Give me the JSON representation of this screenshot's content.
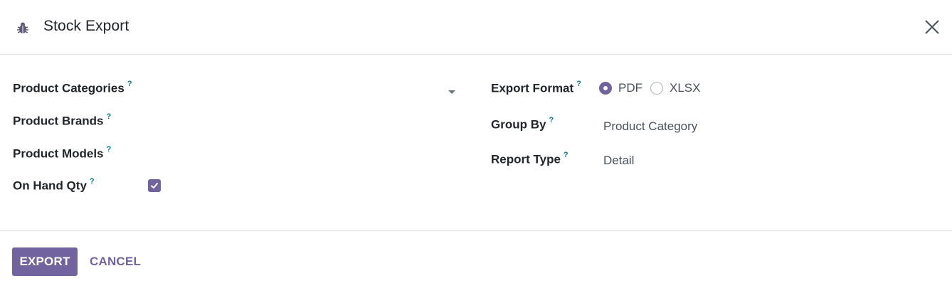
{
  "dialog": {
    "title": "Stock Export",
    "icon": "bug-icon",
    "close_icon": "close-icon"
  },
  "form": {
    "help_mark": "?",
    "product_categories": {
      "label": "Product Categories"
    },
    "product_brands": {
      "label": "Product Brands"
    },
    "product_models": {
      "label": "Product Models"
    },
    "on_hand_qty": {
      "label": "On Hand Qty",
      "checked": true
    },
    "export_format": {
      "label": "Export Format",
      "options": [
        "PDF",
        "XLSX"
      ],
      "selected": "PDF"
    },
    "group_by": {
      "label": "Group By",
      "value": "Product Category"
    },
    "report_type": {
      "label": "Report Type",
      "value": "Detail"
    }
  },
  "footer": {
    "export_label": "EXPORT",
    "cancel_label": "CANCEL"
  },
  "colors": {
    "accent": "#71639e",
    "help": "#017e84",
    "border": "#dee2e6"
  }
}
